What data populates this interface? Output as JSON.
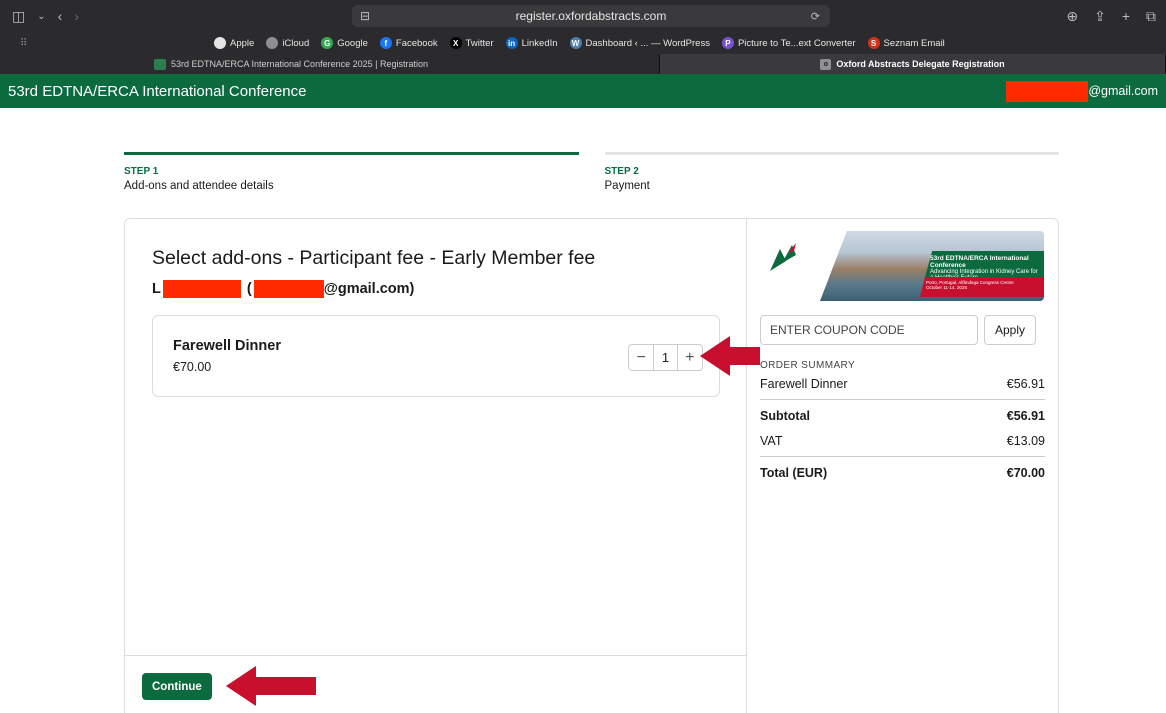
{
  "browser": {
    "address": "register.oxfordabstracts.com",
    "bookmarks": [
      {
        "label": "Apple",
        "color": "#e6e6e6",
        "glyph": ""
      },
      {
        "label": "iCloud",
        "color": "#8e8e93",
        "glyph": ""
      },
      {
        "label": "Google",
        "color": "#34a853",
        "glyph": "G"
      },
      {
        "label": "Facebook",
        "color": "#1877f2",
        "glyph": "f"
      },
      {
        "label": "Twitter",
        "color": "#000000",
        "glyph": "X"
      },
      {
        "label": "LinkedIn",
        "color": "#0a66c2",
        "glyph": "in"
      },
      {
        "label": "Dashboard ‹ ... — WordPress",
        "color": "#4b7fb0",
        "glyph": "W"
      },
      {
        "label": "Picture to Te...ext Converter",
        "color": "#7b4fd1",
        "glyph": "P"
      },
      {
        "label": "Seznam Email",
        "color": "#d4301a",
        "glyph": "S"
      }
    ],
    "tabs": [
      {
        "label": "53rd EDTNA/ERCA International Conference 2025 | Registration"
      },
      {
        "label": "Oxford Abstracts Delegate Registration"
      }
    ]
  },
  "header": {
    "title": "53rd EDTNA/ERCA International Conference",
    "email_suffix": "@gmail.com"
  },
  "steps": [
    {
      "num": "STEP 1",
      "label": "Add-ons and attendee details"
    },
    {
      "num": "STEP 2",
      "label": "Payment"
    }
  ],
  "addons": {
    "title": "Select add-ons - Participant fee - Early Member fee",
    "attendee_initial": "L",
    "attendee_paren_open": "(",
    "attendee_email_suffix": "@gmail.com)",
    "item": {
      "name": "Farewell Dinner",
      "price": "€70.00",
      "quantity": "1"
    },
    "continue_label": "Continue"
  },
  "banner": {
    "logo_text": "EDTNA/ERCA",
    "headline": "53rd EDTNA/ERCA International Conference",
    "tagline": "Advancing Integration in Kidney Care for a Healthier Future",
    "location": "Porto, Portugal, Alfândega Congress Centre",
    "dates": "October 11-14, 2025"
  },
  "summary": {
    "coupon_placeholder": "ENTER COUPON CODE",
    "apply_label": "Apply",
    "title": "ORDER SUMMARY",
    "line_item": {
      "label": "Farewell Dinner",
      "value": "€56.91"
    },
    "subtotal": {
      "label": "Subtotal",
      "value": "€56.91"
    },
    "vat": {
      "label": "VAT",
      "value": "€13.09"
    },
    "total": {
      "label": "Total (EUR)",
      "value": "€70.00"
    }
  },
  "colors": {
    "brand": "#0b6b3f",
    "redaction": "#ff2a00",
    "arrow": "#c8102e"
  }
}
